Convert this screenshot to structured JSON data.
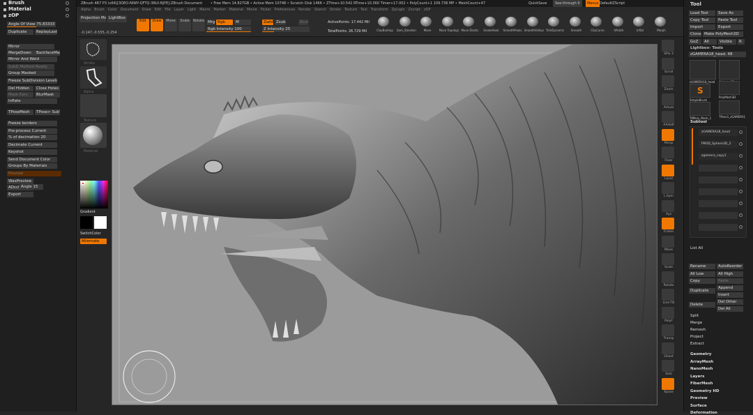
{
  "titlebar": {
    "app": "ZBrush 4R7 P3 (x64)[3OEO-NIWY-QFTQ-3RUI-NJYE]:ZBrush Document",
    "mem": "• Free Mem 14.827GB • Active Mem 10748 • Scratch Disk 1466 • ZTime+10.542 RTime+10.360 Timer+17.002 • PolyCount+1 109.736 MP • MeshCount+47",
    "quicksave": "QuickSave",
    "seethrough": "See-through  0",
    "menus_label": "Menus",
    "script": "DefaultZScript"
  },
  "menubar": [
    "Alpha",
    "Brush",
    "Color",
    "Document",
    "Draw",
    "Edit",
    "File",
    "Layer",
    "Light",
    "Macro",
    "Marker",
    "Material",
    "Movie",
    "Picker",
    "Preferences",
    "Render",
    "Stencil",
    "Stroke",
    "Texture",
    "Tool",
    "Transform",
    "Zplugin",
    "Zscript",
    "zOP"
  ],
  "left_panel": {
    "headers": [
      "Brush",
      "Material",
      "zOP"
    ],
    "angle": "Angle Of View 75.83333",
    "buttons": [
      "Duplicate",
      "ReplayLast",
      "Mirror",
      "MergeDown",
      "BackfaceMask",
      "Mirror And Weld",
      "SubD Method Ready",
      "Group Masked",
      "Freeze SubDivision Levels",
      "Del Hidden",
      "Close Holes",
      "Mask Ears",
      "BlurMask",
      "Inflate",
      "TPoseMesh",
      "TPose> SubT",
      "Freeze borders",
      "Pre-process Current",
      "% of decimation 20",
      "Decimate Current",
      "Keyshot",
      "Send Document Color",
      "Groups By Materials",
      "Preview",
      "Size",
      "WaxPreview",
      "AOcclusion",
      "Angle 15",
      "Export"
    ]
  },
  "toolbar": {
    "projection": "Projection Master",
    "lightbox": "LightBox",
    "coords": "-0.147,-0.555,-0.254",
    "edit": "Edit",
    "draw": "Draw",
    "move": "Move",
    "scale": "Scale",
    "rotate": "Rotate",
    "mrgb": "Mrgb",
    "rgb": "Rgb",
    "m": "M",
    "rgb_intensity": "Rgb Intensity 100",
    "zadd": "Zadd",
    "zsub": "Zsub",
    "zcut": "Zcut",
    "z_intensity": "Z Intensity 25",
    "active_points": "ActivePoints: 17.442  Mil",
    "total_points": "TotalPoints: 26.729  Mil",
    "brushes": [
      "ClayBuildup",
      "Dam_Standard",
      "Move",
      "Move Topological",
      "Move Elastic",
      "SnakeHook",
      "SmoothPeaks",
      "SmoothValleys",
      "TrimDynamic",
      "Smooth",
      "ClipCurve",
      "hPolish",
      "Inflat",
      "Morph"
    ]
  },
  "side_column": {
    "labels": [
      "Stroke",
      "Alpha",
      "Texture",
      "Material",
      "Gradient",
      "SwitchColor",
      "Alternate"
    ]
  },
  "right_tools": [
    "SPix 3",
    "Scroll",
    "Zoom",
    "Actual",
    "AAHalf",
    "Persp",
    "Floor",
    "Local",
    "L.Sym",
    "Xyz",
    "Frame",
    "Move",
    "Scale",
    "Rotate",
    "Line Fill",
    "PolyF",
    "Transp",
    "Ghost",
    "Solo",
    "Xpose"
  ],
  "right_panel": {
    "tool_header": "Tool",
    "buttons": [
      "Load Tool",
      "Save As",
      "Copy Tool",
      "Paste Tool",
      "Import",
      "Export",
      "Clone",
      "Make PolyMesh3D",
      "GoZ",
      "All",
      "Visible",
      "R"
    ],
    "lightbox_tools": "Lightbox› Tools",
    "current_tool": "zGAMERA18_head. 48",
    "thumbs": [
      "zGAMERA18_head",
      "Cylinder3D",
      "SimpleBrush",
      "PolyMesh3D",
      "TMPoly_Mesh_1",
      "TPose1_zGAMERA18"
    ],
    "subtool_header": "Subtool",
    "subtools": [
      "zGAMERA18_head",
      "PM3D_Sphere3D_2",
      "zgamera_copy1"
    ],
    "list_all": "List All",
    "actions": [
      "Rename",
      "AutoReorder",
      "All Low",
      "All High",
      "Copy",
      "Paste",
      "Duplicate",
      "Append",
      "Insert",
      "Delete",
      "Del Other",
      "Del All",
      "Split",
      "Merge",
      "Remesh",
      "Project",
      "Extract"
    ],
    "sections": [
      "Geometry",
      "ArrayMesh",
      "NanoMesh",
      "Layers",
      "FiberMesh",
      "Geometry HD",
      "Preview",
      "Surface",
      "Deformation"
    ]
  },
  "colors": {
    "accent": "#f07800",
    "canvas": "#9b9b9b",
    "panel": "#1f1f1f"
  }
}
